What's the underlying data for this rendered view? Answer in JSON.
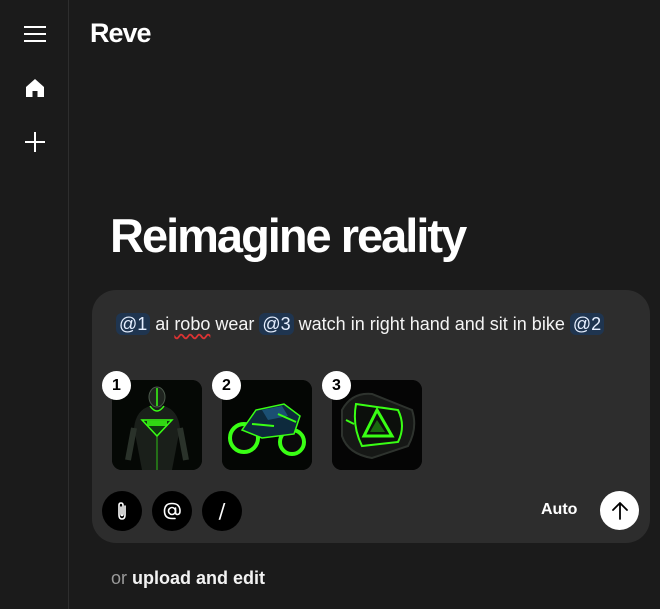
{
  "sidebar": {
    "menu_icon": "hamburger-menu-icon",
    "home_icon": "home-icon",
    "new_icon": "plus-icon"
  },
  "header": {
    "logo": "Reve"
  },
  "main": {
    "headline": "Reimagine reality"
  },
  "composer": {
    "prompt_parts": {
      "m1": "@1",
      "t1": " ai ",
      "t2": "robo",
      "t3": " wear ",
      "m2": "@3",
      "t4": " watch in right hand and sit in bike ",
      "m3": "@2"
    },
    "attachments": [
      {
        "badge": "1",
        "subject": "robot figure"
      },
      {
        "badge": "2",
        "subject": "neon motorbike"
      },
      {
        "badge": "3",
        "subject": "neon watch"
      }
    ],
    "tools": {
      "attach_icon": "paperclip-icon",
      "mention_icon": "at-sign-icon",
      "command_label": "/"
    },
    "mode_label": "Auto",
    "send_icon": "arrow-up-icon"
  },
  "footer": {
    "or_text": "or",
    "upload_link": "upload and edit"
  },
  "colors": {
    "background": "#1b1b1b",
    "composer_bg": "#2d2d2d",
    "mention_bg": "#1f3550",
    "neon_green": "#39ff14"
  }
}
